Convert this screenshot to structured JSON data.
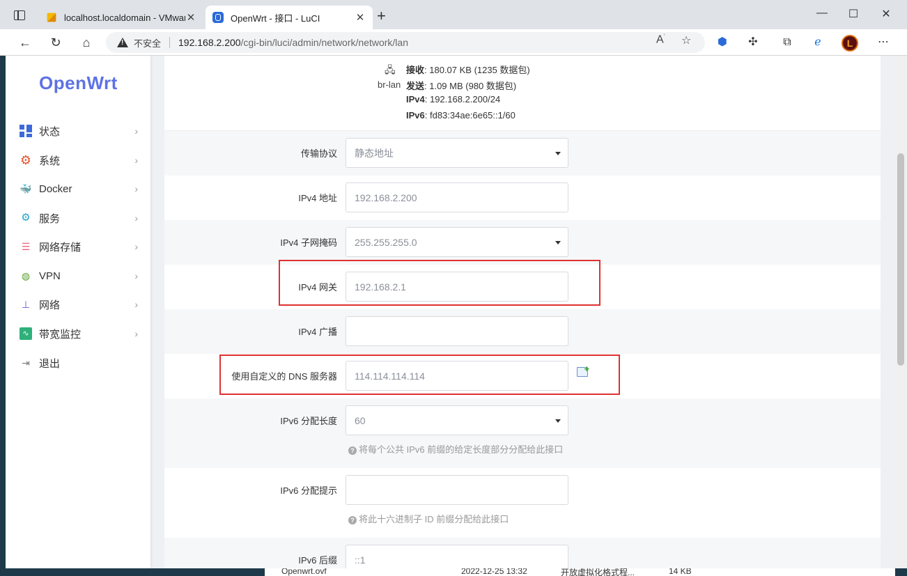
{
  "browser": {
    "tabs": [
      {
        "label": "localhost.localdomain - VMware",
        "active": false
      },
      {
        "label": "OpenWrt - 接口 - LuCI",
        "active": true
      }
    ],
    "security_label": "不安全",
    "url_host": "192.168.2.200",
    "url_path": "/cgi-bin/luci/admin/network/network/lan"
  },
  "sidebar": {
    "logo": "OpenWrt",
    "items": [
      {
        "label": "状态",
        "icon": "dashboard-icon"
      },
      {
        "label": "系统",
        "icon": "gear-icon"
      },
      {
        "label": "Docker",
        "icon": "docker-icon"
      },
      {
        "label": "服务",
        "icon": "services-icon"
      },
      {
        "label": "网络存储",
        "icon": "storage-icon"
      },
      {
        "label": "VPN",
        "icon": "vpn-icon"
      },
      {
        "label": "网络",
        "icon": "network-icon"
      },
      {
        "label": "带宽监控",
        "icon": "monitor-icon"
      },
      {
        "label": "退出",
        "icon": "logout-icon"
      }
    ]
  },
  "interface": {
    "name": "br-lan",
    "rx_label": "接收",
    "rx_value": ": 180.07 KB (1235 数据包)",
    "tx_label": "发送",
    "tx_value": ": 1.09 MB (980 数据包)",
    "ipv4_label": "IPv4",
    "ipv4_value": ": 192.168.2.200/24",
    "ipv6_label": "IPv6",
    "ipv6_value": ": fd83:34ae:6e65::1/60"
  },
  "form": {
    "protocol": {
      "label": "传输协议",
      "value": "静态地址"
    },
    "ipv4_addr": {
      "label": "IPv4 地址",
      "value": "192.168.2.200"
    },
    "ipv4_mask": {
      "label": "IPv4 子网掩码",
      "value": "255.255.255.0"
    },
    "ipv4_gw": {
      "label": "IPv4 网关",
      "value": "192.168.2.1"
    },
    "ipv4_bcast": {
      "label": "IPv4 广播",
      "value": ""
    },
    "dns": {
      "label": "使用自定义的 DNS 服务器",
      "value": "114.114.114.114"
    },
    "ipv6_len": {
      "label": "IPv6 分配长度",
      "value": "60",
      "hint": "将每个公共 IPv6 前缀的给定长度部分分配给此接口"
    },
    "ipv6_hint": {
      "label": "IPv6 分配提示",
      "value": "",
      "hint": "将此十六进制子 ID 前缀分配给此接口"
    },
    "ipv6_suffix": {
      "label": "IPv6 后缀",
      "value": "::1"
    }
  },
  "background_window": {
    "file": "Openwrt.ovf",
    "date": "2022-12-25 13:32",
    "type": "开放虚拟化格式程...",
    "size": "14 KB"
  }
}
